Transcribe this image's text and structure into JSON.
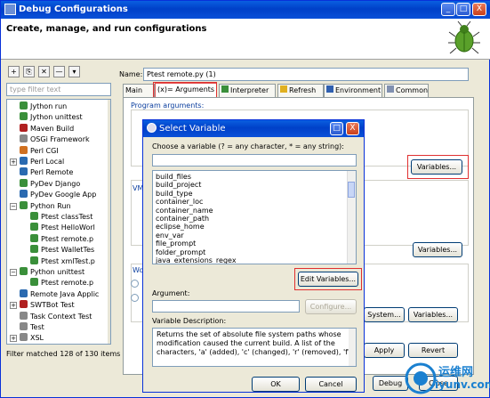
{
  "window": {
    "title": "Debug Configurations",
    "header": "Create, manage, and run configurations",
    "controls": {
      "minimize": "_",
      "maximize": "□",
      "close": "X"
    }
  },
  "sidebar": {
    "toolbar": [
      {
        "name": "new-config",
        "glyph": "+"
      },
      {
        "name": "duplicate",
        "glyph": "⎘"
      },
      {
        "name": "delete",
        "glyph": "✕"
      },
      {
        "name": "collapse",
        "glyph": "—"
      },
      {
        "name": "filter",
        "glyph": "▾"
      }
    ],
    "filter_placeholder": "type filter text",
    "items": [
      {
        "label": "Jython run",
        "indent": 1,
        "color": "#3a8f3a"
      },
      {
        "label": "Jython unittest",
        "indent": 1,
        "color": "#3a8f3a"
      },
      {
        "label": "Maven Build",
        "indent": 1,
        "color": "#b02020"
      },
      {
        "label": "OSGi Framework",
        "indent": 1,
        "color": "#888888"
      },
      {
        "label": "Perl CGI",
        "indent": 1,
        "color": "#d07020"
      },
      {
        "label": "Perl Local",
        "indent": 1,
        "color": "#2a6ab0",
        "expander": "+"
      },
      {
        "label": "Perl Remote",
        "indent": 1,
        "color": "#2a6ab0"
      },
      {
        "label": "PyDev Django",
        "indent": 1,
        "color": "#3a8f3a"
      },
      {
        "label": "PyDev Google App",
        "indent": 1,
        "color": "#2a6ab0"
      },
      {
        "label": "Python Run",
        "indent": 1,
        "color": "#3a8f3a",
        "expander": "−"
      },
      {
        "label": "Ptest classTest",
        "indent": 2,
        "color": "#3a8f3a"
      },
      {
        "label": "Ptest HelloWorl",
        "indent": 2,
        "color": "#3a8f3a"
      },
      {
        "label": "Ptest remote.p",
        "indent": 2,
        "color": "#3a8f3a"
      },
      {
        "label": "Ptest WalletTes",
        "indent": 2,
        "color": "#3a8f3a"
      },
      {
        "label": "Ptest xmlTest.p",
        "indent": 2,
        "color": "#3a8f3a"
      },
      {
        "label": "Python unittest",
        "indent": 1,
        "color": "#3a8f3a",
        "expander": "−"
      },
      {
        "label": "Ptest remote.p",
        "indent": 2,
        "color": "#3a8f3a"
      },
      {
        "label": "Remote Java Applic",
        "indent": 1,
        "color": "#2a6ab0"
      },
      {
        "label": "SWTBot Test",
        "indent": 1,
        "color": "#b02020",
        "expander": "+"
      },
      {
        "label": "Task Context Test",
        "indent": 1,
        "color": "#888888"
      },
      {
        "label": "Test",
        "indent": 1,
        "color": "#888888"
      },
      {
        "label": "XSL",
        "indent": 1,
        "color": "#888888",
        "expander": "+"
      }
    ],
    "status": "Filter matched 128 of 130 items"
  },
  "main": {
    "name_label": "Name:",
    "name_value": "Ptest remote.py (1)",
    "tabs": [
      {
        "label": "Main"
      },
      {
        "label": "(x)= Arguments",
        "active": true
      },
      {
        "label": "Interpreter"
      },
      {
        "label": "Refresh"
      },
      {
        "label": "Environment"
      },
      {
        "label": "Common"
      }
    ],
    "program_args_label": "Program arguments:",
    "vm_label": "VM",
    "wo_label": "Wo",
    "variables_button": "Variables...",
    "variables_button2": "Variables...",
    "system_button": "System...",
    "variables_button3": "Variables...",
    "apply_button": "Apply",
    "revert_button": "Revert",
    "debug_button": "Debug",
    "close_button": "Close"
  },
  "dialog": {
    "title": "Select Variable",
    "choose_label": "Choose a variable (? = any character, * = any string):",
    "variables": [
      "build_files",
      "build_project",
      "build_type",
      "container_loc",
      "container_name",
      "container_path",
      "eclipse_home",
      "env_var",
      "file_prompt",
      "folder_prompt",
      "java_extensions_regex"
    ],
    "edit_variables_button": "Edit Variables...",
    "argument_label": "Argument:",
    "configure_button": "Configure...",
    "description_label": "Variable Description:",
    "description": "Returns the set of absolute file system paths whose modification caused the current build.  A list of the characters, 'a' (added), 'c' (changed), 'r' (removed), 'f'",
    "ok_button": "OK",
    "cancel_button": "Cancel"
  },
  "watermark": {
    "line1": "运维网",
    "line2": "iyunv.com"
  }
}
